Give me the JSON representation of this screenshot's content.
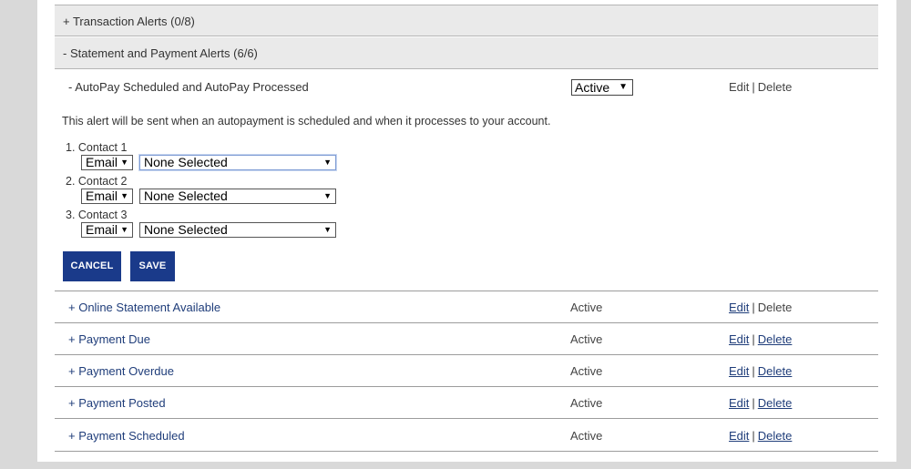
{
  "sections": [
    {
      "label": "+ Transaction Alerts (0/8)"
    },
    {
      "label": "- Statement and Payment Alerts (6/6)"
    }
  ],
  "expanded": {
    "title": "- AutoPay Scheduled and AutoPay Processed",
    "status": "Active",
    "edit": "Edit",
    "delete": "Delete",
    "description": "This alert will be sent when an autopayment is scheduled and when it processes to your account.",
    "contacts": [
      {
        "label": "1.  Contact 1",
        "method": "Email",
        "recipient": "None Selected"
      },
      {
        "label": "2.  Contact 2",
        "method": "Email",
        "recipient": "None Selected"
      },
      {
        "label": "3.  Contact 3",
        "method": "Email",
        "recipient": "None Selected"
      }
    ],
    "cancel_label": "CANCEL",
    "save_label": "SAVE"
  },
  "alerts": [
    {
      "name": "+ Online Statement Available",
      "status": "Active",
      "edit": "Edit",
      "delete": "Delete"
    },
    {
      "name": "+ Payment Due",
      "status": "Active",
      "edit": "Edit",
      "delete": "Delete"
    },
    {
      "name": "+ Payment Overdue",
      "status": "Active",
      "edit": "Edit",
      "delete": "Delete"
    },
    {
      "name": "+ Payment Posted",
      "status": "Active",
      "edit": "Edit",
      "delete": "Delete"
    },
    {
      "name": "+ Payment Scheduled",
      "status": "Active",
      "edit": "Edit",
      "delete": "Delete"
    }
  ],
  "separator": "|",
  "icons": {
    "dropdown": "caret-down-icon"
  },
  "colors": {
    "primary_button": "#1a3a8a",
    "link": "#1f3d7a"
  }
}
